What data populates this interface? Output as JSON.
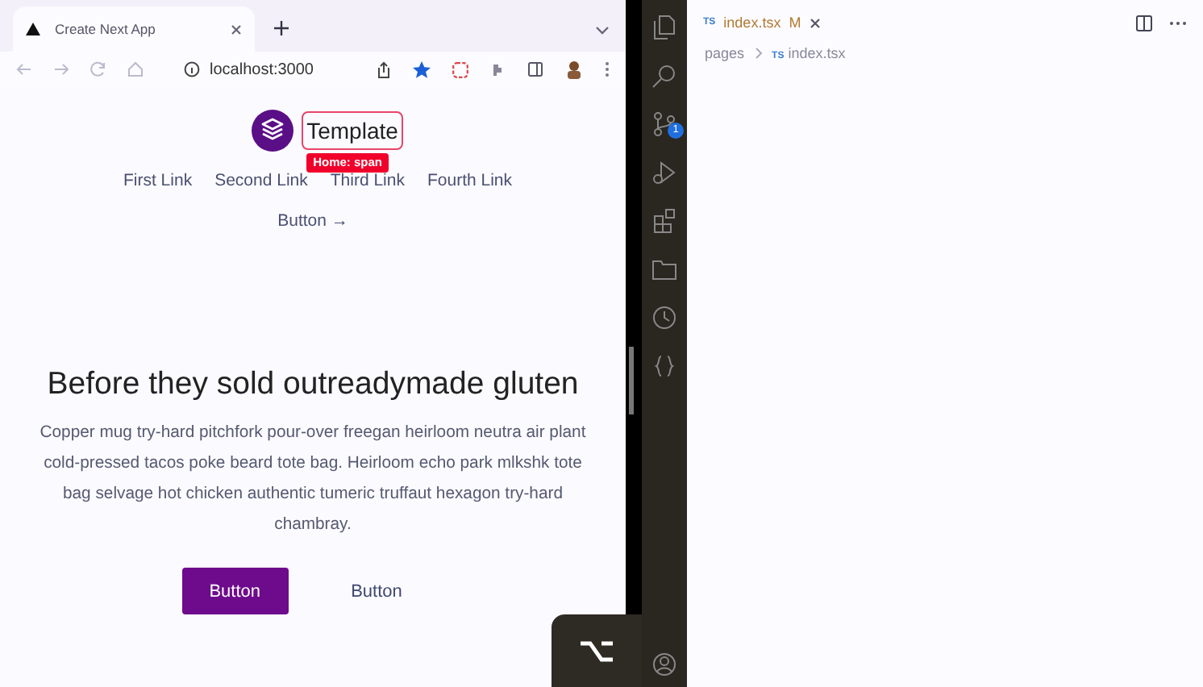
{
  "browser": {
    "tab": {
      "title": "Create Next App"
    },
    "address": "localhost:3000"
  },
  "page": {
    "logo_text": "Template",
    "inspector_label": "Home: span",
    "nav_links": [
      "First Link",
      "Second Link",
      "Third Link",
      "Fourth Link"
    ],
    "nav_button": "Button →",
    "heading": "Before they sold outreadymade gluten",
    "paragraph": "Copper mug try-hard pitchfork pour-over freegan heirloom neutra air plant cold-pressed tacos poke beard tote bag. Heirloom echo park mlkshk tote bag selvage hot chicken authentic tumeric truffaut hexagon try-hard chambray.",
    "buttons": [
      {
        "label": "Button",
        "kind": "primary"
      },
      {
        "label": "Button",
        "kind": "plain"
      }
    ]
  },
  "editor": {
    "tab": {
      "lang": "TS",
      "file": "index.tsx",
      "status": "M"
    },
    "breadcrumb": {
      "folder": "pages",
      "lang": "TS",
      "file": "index.tsx"
    },
    "source_control_badge": "1"
  }
}
